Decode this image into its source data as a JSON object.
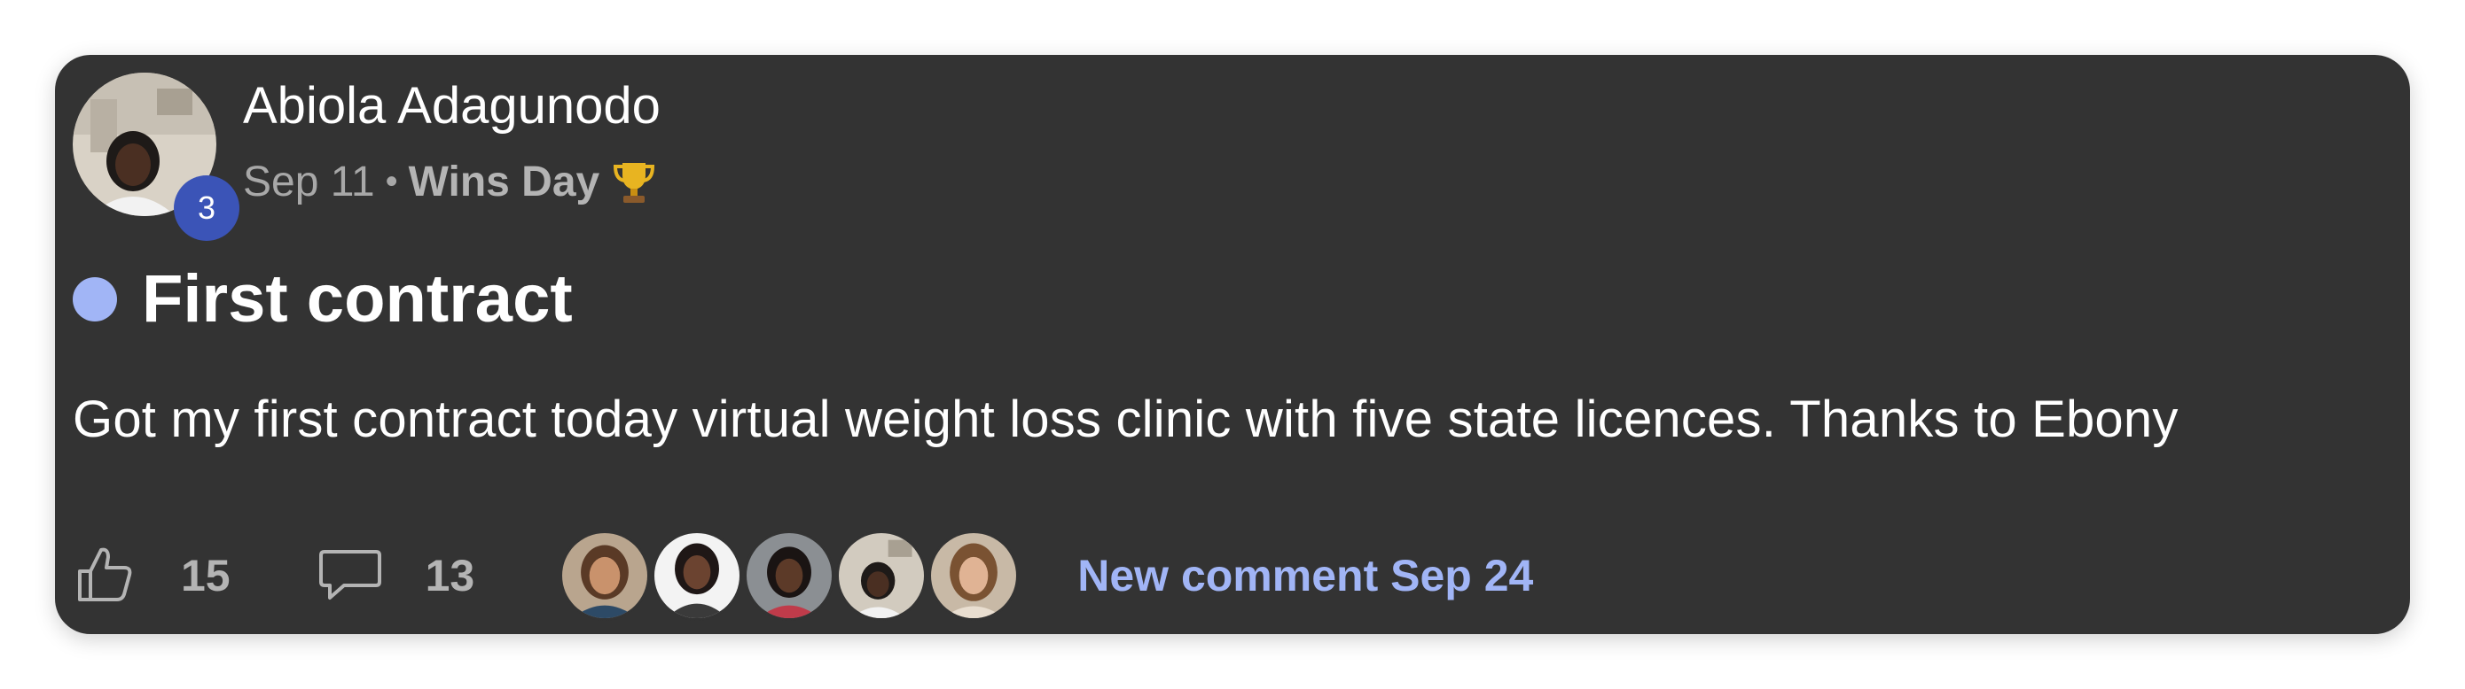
{
  "post": {
    "author": {
      "name": "Abiola Adagunodo",
      "level": "3"
    },
    "date": "Sep 11",
    "separator": "•",
    "category": "Wins Day",
    "category_icon": "trophy-icon",
    "title": "First contract",
    "body": "Got my first contract today virtual weight loss clinic with five state licences. Thanks to Ebony",
    "likes": "15",
    "comments": "13",
    "new_comment": "New comment Sep 24"
  },
  "colors": {
    "card_background": "#333333",
    "accent": "#a1b5f6",
    "level_badge": "#3b54b7",
    "muted_text": "#a8a8a8"
  }
}
